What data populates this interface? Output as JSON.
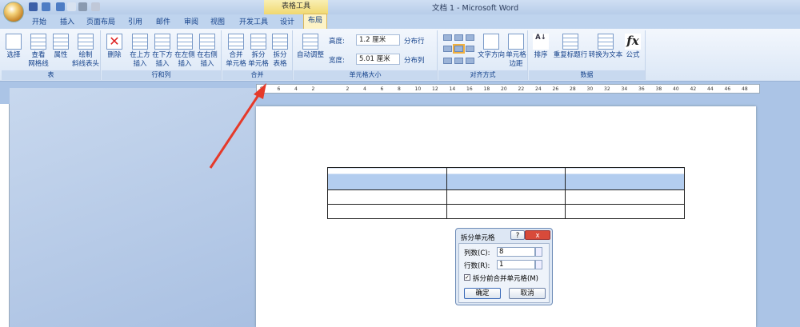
{
  "window": {
    "title": "文档 1 - Microsoft Word",
    "context_tab_group": "表格工具"
  },
  "tabs": [
    "开始",
    "插入",
    "页面布局",
    "引用",
    "邮件",
    "审阅",
    "视图",
    "开发工具",
    "设计",
    "布局"
  ],
  "active_tab": "布局",
  "ribbon": {
    "table_group": {
      "label": "表",
      "buttons": [
        "选择",
        "查看\n网格线",
        "属性",
        "绘制\n斜线表头"
      ]
    },
    "rows_cols_group": {
      "label": "行和列",
      "buttons": [
        "删除",
        "在上方\n插入",
        "在下方\n插入",
        "在左侧\n插入",
        "在右侧\n插入"
      ]
    },
    "merge_group": {
      "label": "合并",
      "buttons": [
        "合并\n单元格",
        "拆分\n单元格",
        "拆分\n表格"
      ]
    },
    "cell_size_group": {
      "label": "单元格大小",
      "autofit": "自动调整",
      "height_label": "高度:",
      "height_value": "1.2 厘米",
      "width_label": "宽度:",
      "width_value": "5.01 厘米",
      "distribute_rows": "分布行",
      "distribute_cols": "分布列"
    },
    "alignment_group": {
      "label": "对齐方式",
      "text_direction": "文字方向",
      "cell_margins": "单元格\n边距"
    },
    "data_group": {
      "label": "数据",
      "buttons": [
        "排序",
        "重复标题行",
        "转换为文本",
        "公式"
      ]
    }
  },
  "ruler_labels": [
    "8",
    "6",
    "4",
    "2",
    "",
    "2",
    "4",
    "6",
    "8",
    "10",
    "12",
    "14",
    "16",
    "18",
    "20",
    "22",
    "24",
    "26",
    "28",
    "30",
    "32",
    "34",
    "36",
    "38",
    "40",
    "42",
    "44",
    "46",
    "48"
  ],
  "dialog": {
    "title": "拆分单元格",
    "help": "?",
    "close": "x",
    "cols_label": "列数(C):",
    "cols_value": "8",
    "rows_label": "行数(R):",
    "rows_value": "1",
    "merge_before_split": "拆分前合并单元格(M)",
    "merge_checked": true,
    "ok": "确定",
    "cancel": "取消"
  },
  "colors": {
    "accent": "#15428b",
    "highlight": "#b3cdef",
    "arrow": "#e53a2a"
  }
}
